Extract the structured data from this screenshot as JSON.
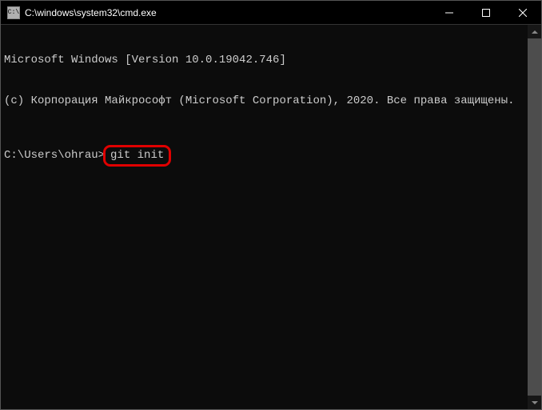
{
  "titlebar": {
    "icon_text": "C:\\",
    "title": "C:\\windows\\system32\\cmd.exe"
  },
  "terminal": {
    "line1": "Microsoft Windows [Version 10.0.19042.746]",
    "line2": "(c) Корпорация Майкрософт (Microsoft Corporation), 2020. Все права защищены.",
    "prompt": "C:\\Users\\ohrau>",
    "command": "git init"
  }
}
